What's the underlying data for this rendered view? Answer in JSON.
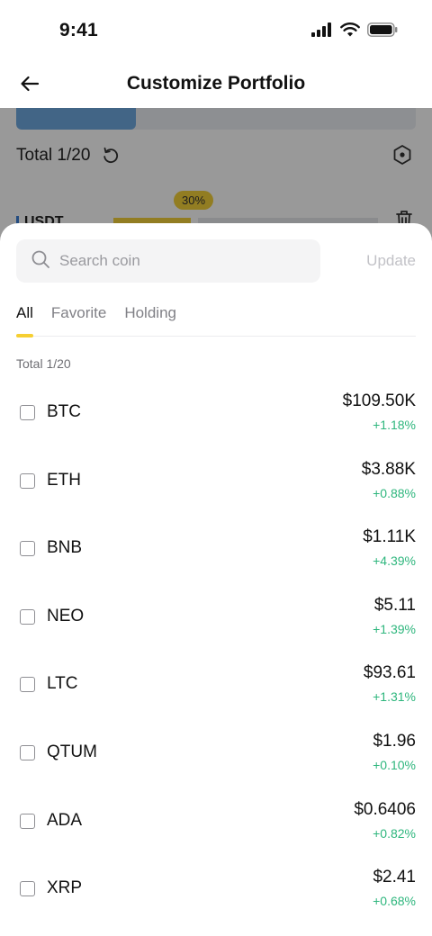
{
  "status_bar": {
    "time": "9:41",
    "icons": [
      "signal-icon",
      "wifi-icon",
      "battery-icon"
    ]
  },
  "header": {
    "title": "Customize Portfolio",
    "back_icon": "back-arrow-icon"
  },
  "background": {
    "allocation_fraction": 0.3,
    "total_label": "Total 1/20",
    "percent_badge": "30%",
    "coin_label": "USDT",
    "coin_allocation_fraction": 0.3,
    "icons": [
      "reset-icon",
      "hexagon-settings-icon",
      "trash-icon"
    ]
  },
  "sheet": {
    "search": {
      "placeholder": "Search coin",
      "value": ""
    },
    "update_label": "Update",
    "tabs": [
      {
        "label": "All",
        "active": true
      },
      {
        "label": "Favorite",
        "active": false
      },
      {
        "label": "Holding",
        "active": false
      }
    ],
    "total_label": "Total 1/20",
    "coins": [
      {
        "symbol": "BTC",
        "price": "$109.50K",
        "change": "+1.18%",
        "checked": false
      },
      {
        "symbol": "ETH",
        "price": "$3.88K",
        "change": "+0.88%",
        "checked": false
      },
      {
        "symbol": "BNB",
        "price": "$1.11K",
        "change": "+4.39%",
        "checked": false
      },
      {
        "symbol": "NEO",
        "price": "$5.11",
        "change": "+1.39%",
        "checked": false
      },
      {
        "symbol": "LTC",
        "price": "$93.61",
        "change": "+1.31%",
        "checked": false
      },
      {
        "symbol": "QTUM",
        "price": "$1.96",
        "change": "+0.10%",
        "checked": false
      },
      {
        "symbol": "ADA",
        "price": "$0.6406",
        "change": "+0.82%",
        "checked": false
      },
      {
        "symbol": "XRP",
        "price": "$2.41",
        "change": "+0.68%",
        "checked": false
      }
    ]
  },
  "colors": {
    "accent_yellow": "#f6cf32",
    "positive_green": "#2eb67d",
    "allocation_blue": "#6fa8e0"
  }
}
